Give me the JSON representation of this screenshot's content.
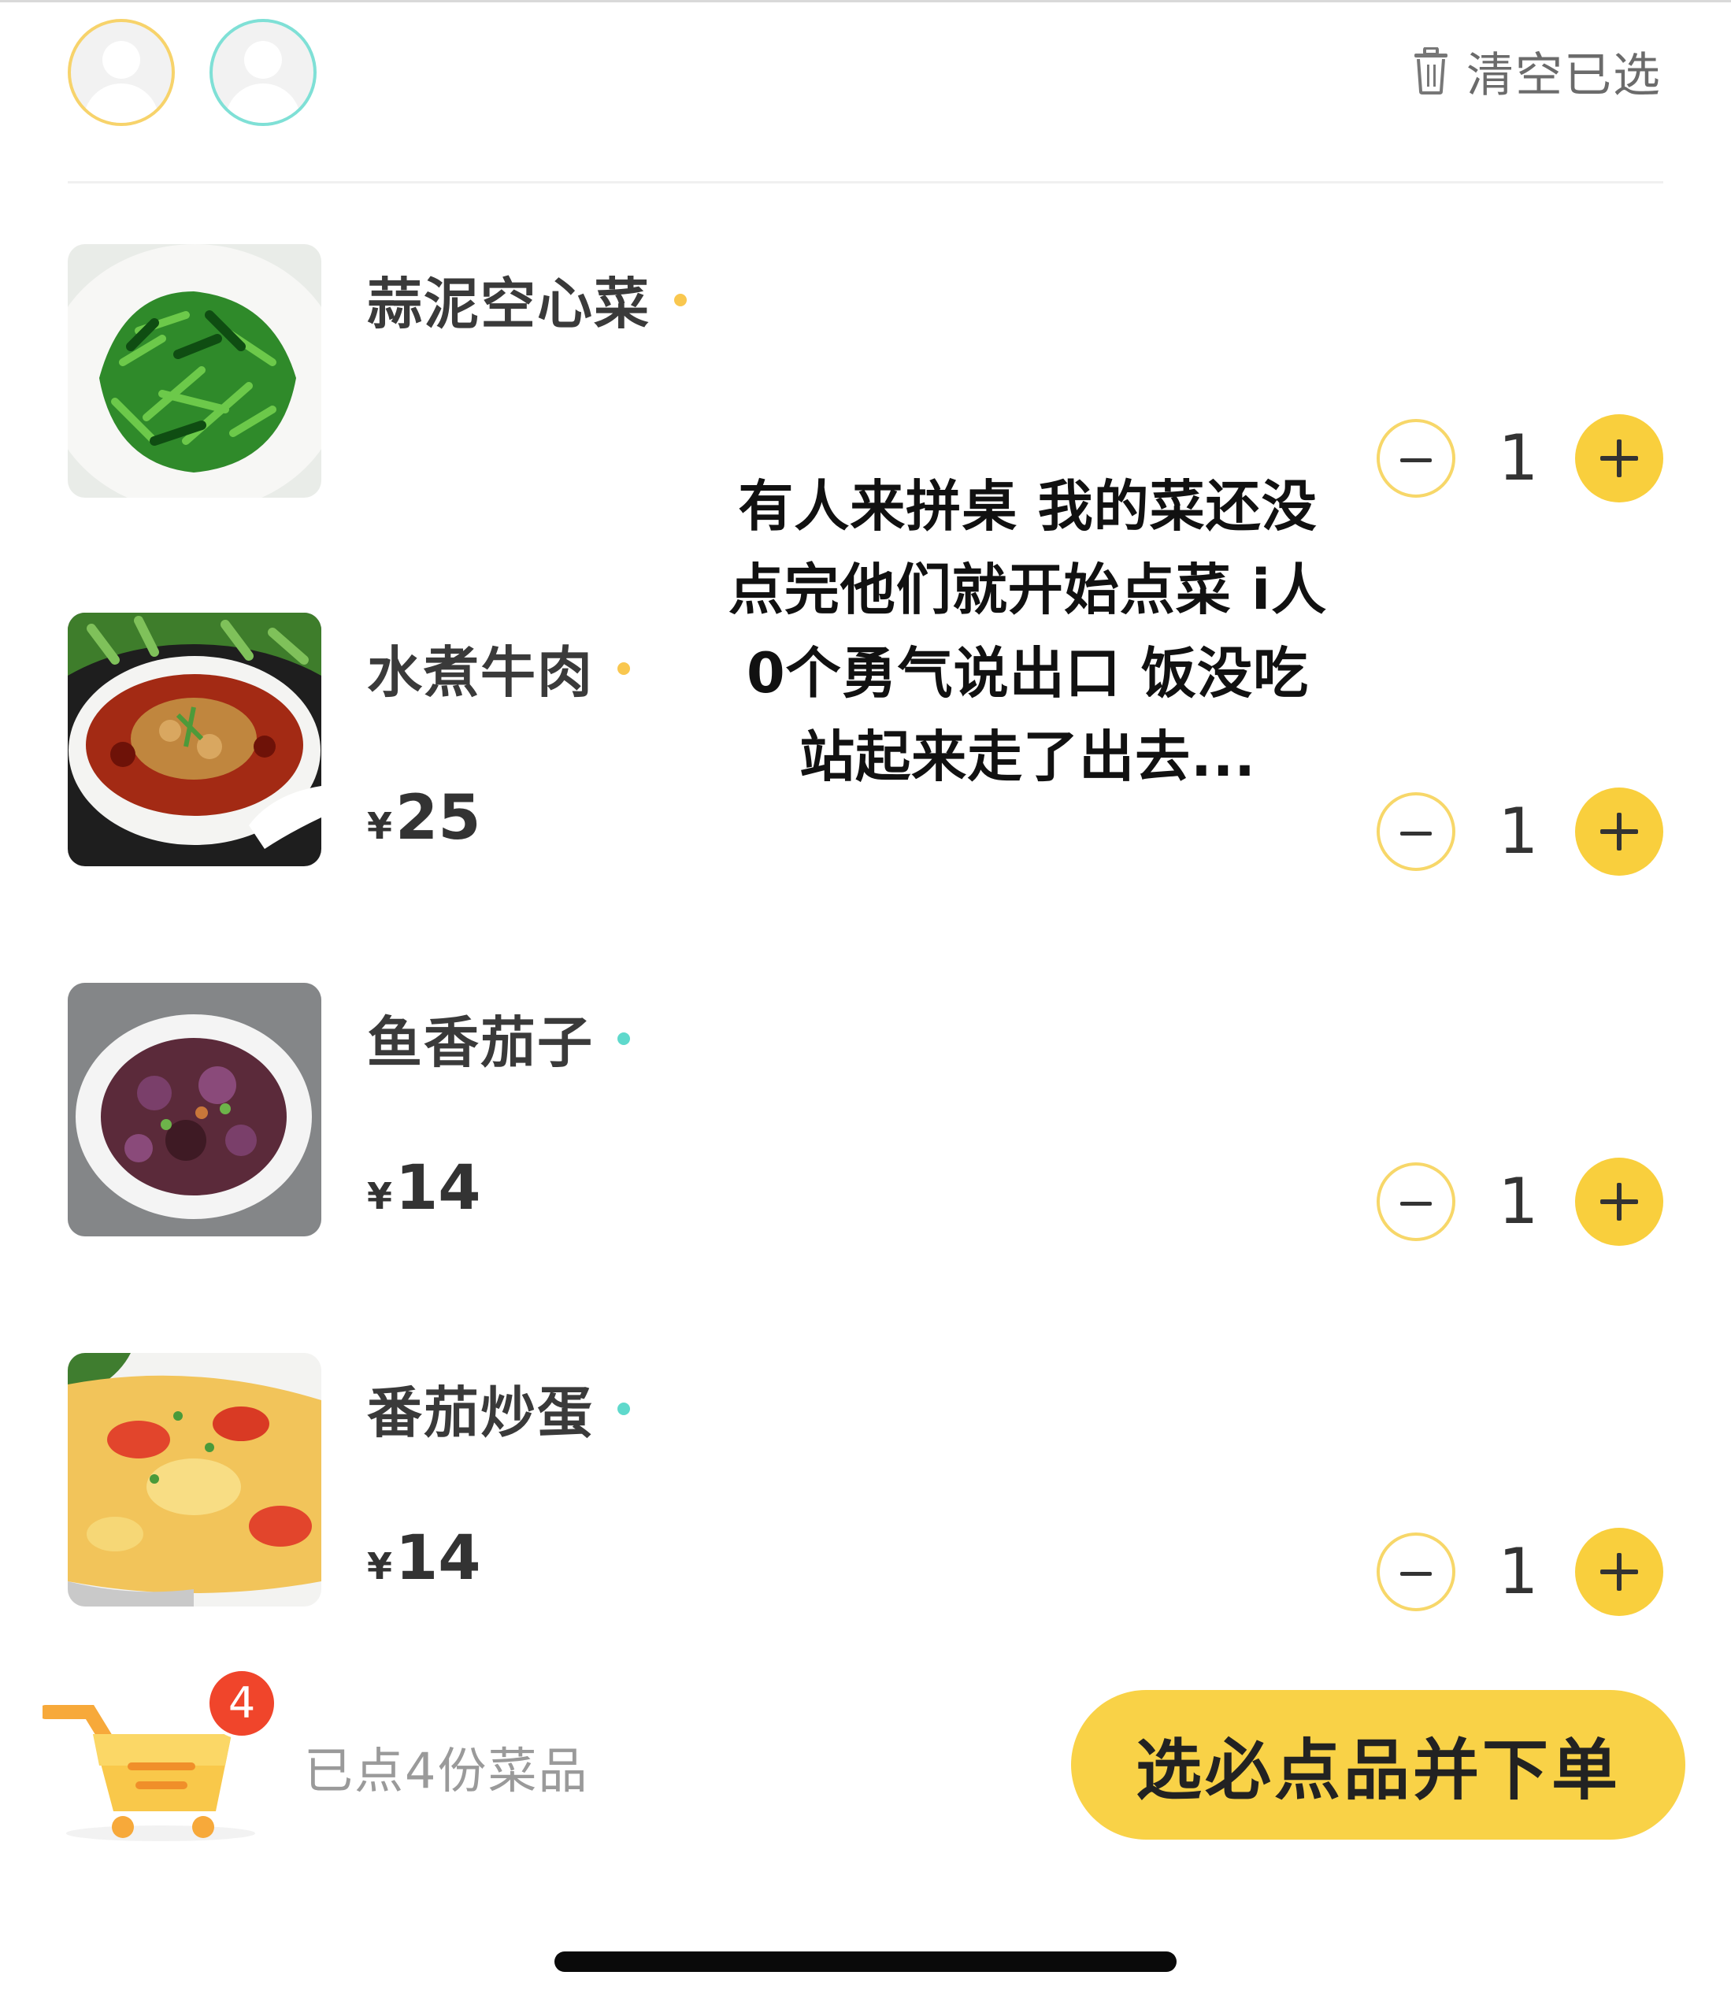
{
  "header": {
    "clear_label": "清空已选"
  },
  "items": [
    {
      "name": "蒜泥空心菜",
      "currency": "",
      "price": "",
      "qty": "1",
      "dot_color": "#f9c74f"
    },
    {
      "name": "水煮牛肉",
      "currency": "¥",
      "price": "25",
      "qty": "1",
      "dot_color": "#f9c74f"
    },
    {
      "name": "鱼香茄子",
      "currency": "¥",
      "price": "14",
      "qty": "1",
      "dot_color": "#5fd9cc"
    },
    {
      "name": "番茄炒蛋",
      "currency": "¥",
      "price": "14",
      "qty": "1",
      "dot_color": "#5fd9cc"
    }
  ],
  "caption": {
    "lines": [
      "有人来拼桌 我的菜还没",
      "点完他们就开始点菜 i人",
      "0个勇气说出口 饭没吃",
      "站起来走了出去..."
    ]
  },
  "footer": {
    "cart_badge": "4",
    "summary": "已点4份菜品",
    "order_button": "选必点品并下单"
  },
  "colors": {
    "accent": "#f9d247",
    "badge": "#f0452b"
  },
  "icons": {
    "trash": "trash-icon",
    "cart": "cart-icon",
    "minus": "minus-icon",
    "plus": "plus-icon",
    "avatar": "avatar-placeholder-icon"
  }
}
